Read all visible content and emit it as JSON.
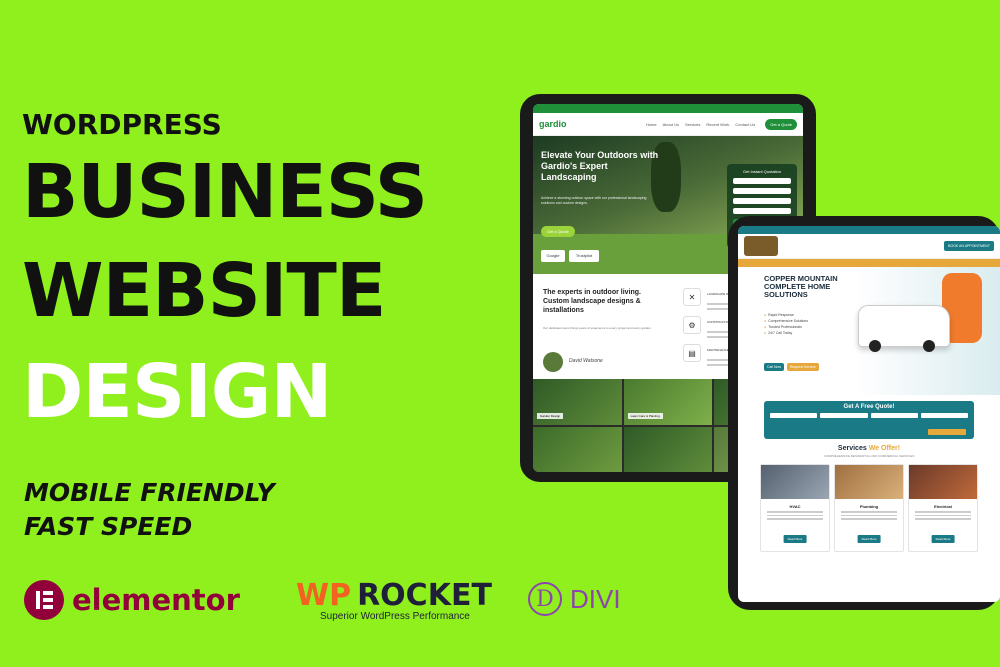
{
  "headline": {
    "line1": "WORDPRESS",
    "line2": "BUSINESS",
    "line3": "WEBSITE",
    "line4": "DESIGN"
  },
  "features": [
    "MOBILE FRIENDLY",
    "FAST SPEED"
  ],
  "logos": {
    "elementor": "elementor",
    "wprocket_prefix": "WP",
    "wprocket_name": "ROCKET",
    "wprocket_tagline": "Superior WordPress Performance",
    "divi_letter": "D",
    "divi_name": "DIVI"
  },
  "colors": {
    "background": "#8ff01e",
    "elementor": "#92003b",
    "wprocket": "#f26322",
    "divi": "#8e44ad",
    "gardio_green": "#1f8f3a",
    "copper_teal": "#1a7b86"
  },
  "tablet1": {
    "logo": "gardio",
    "nav": [
      "Home",
      "About Us",
      "Services",
      "Recent Work",
      "Contact Us"
    ],
    "cta": "Get a Quote",
    "hero_title": "Elevate Your Outdoors with Gardio's Expert Landscaping",
    "hero_text": "Achieve a stunning outdoor space with our professional landscaping solutions and custom designs.",
    "hero_button": "Get a Quote",
    "quote_title": "Get Instant Quotation",
    "badge_google": "Google",
    "badge_trustpilot": "Trustpilot",
    "section_title": "The experts in outdoor living. Custom landscape designs & installations",
    "section_text": "Our dedicated team brings years of experience to every project and every garden.",
    "signature": "David Watsone",
    "services": [
      "LANDSCAPE DESIGN",
      "CONSTRUCTION",
      "MAINTENANCE"
    ],
    "gallery_labels": [
      "Garden Design",
      "Lawn Care & Planting"
    ]
  },
  "tablet2": {
    "cta": "BOOK AN APPOINTMENT",
    "hero_title": "COPPER MOUNTAIN COMPLETE HOME SOLUTIONS",
    "hero_points": [
      "Rapid Response",
      "Comprehensive Solutions",
      "Trusted Professionals",
      "24/7 Call Today"
    ],
    "badge_call": "Call Now",
    "badge_request": "Request Service",
    "quote_title": "Get A Free Quote!",
    "services_heading_a": "Services",
    "services_heading_b": "We Offer!",
    "services_sub": "COMPREHENSIVE RESIDENTIAL AND COMMERCIAL SERVICES",
    "cards": [
      "HVAC",
      "Plumbing",
      "Electrical"
    ],
    "card_button": "Read More"
  }
}
